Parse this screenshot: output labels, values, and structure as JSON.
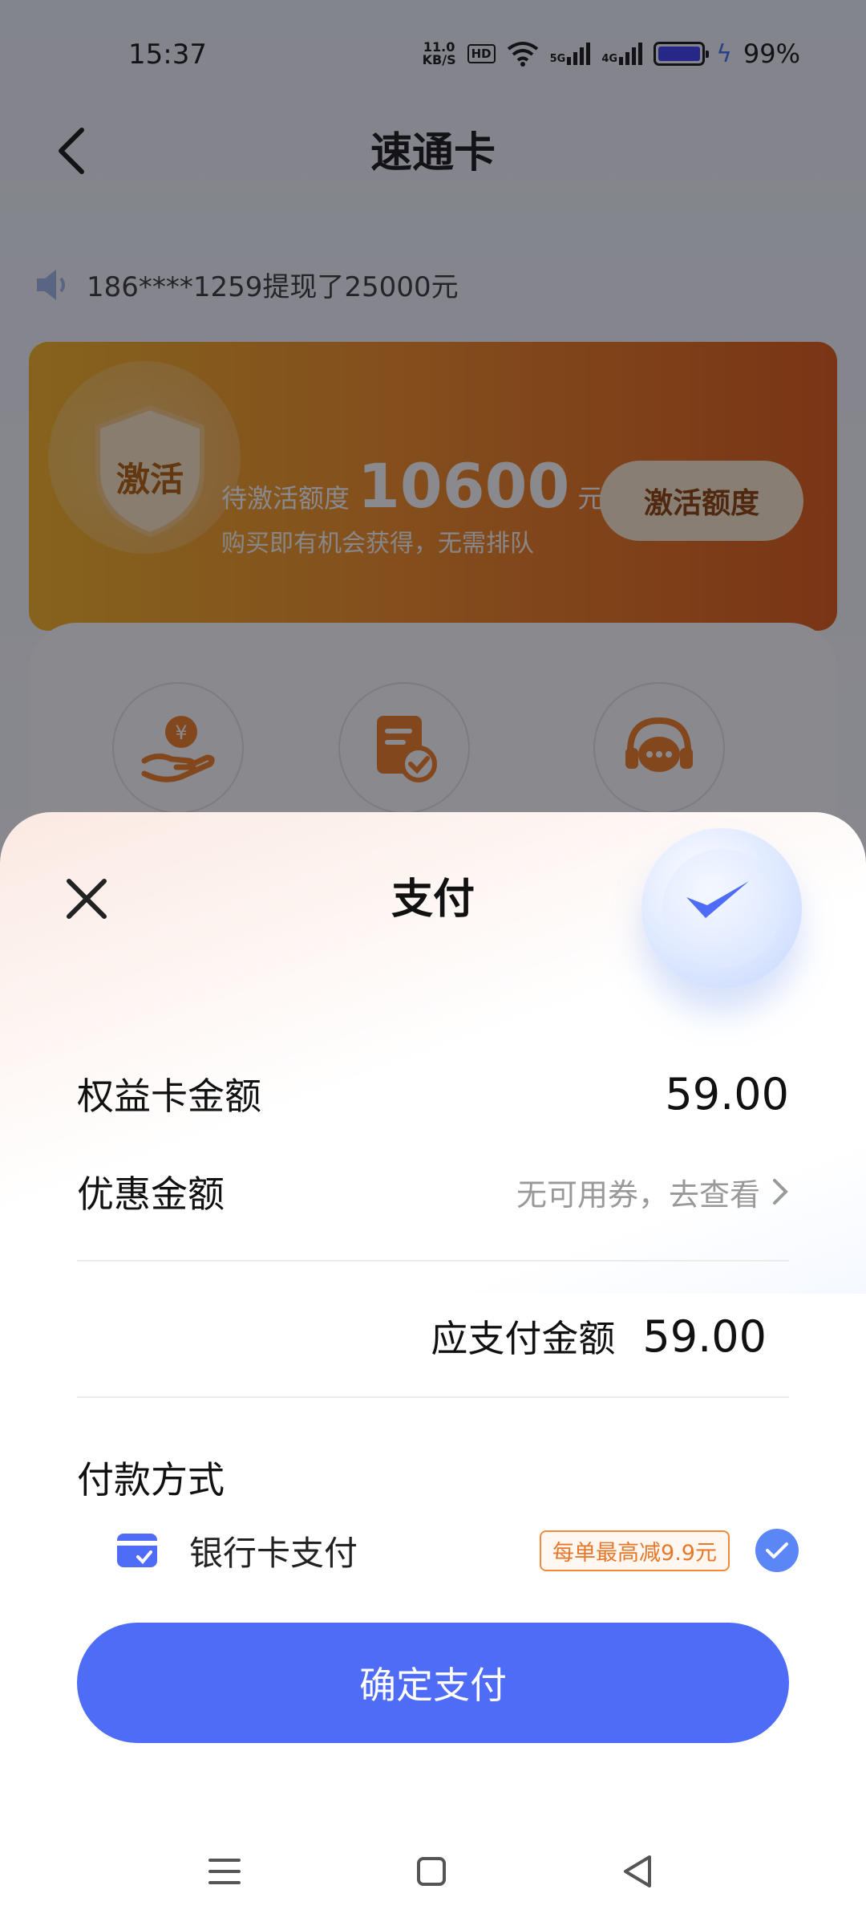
{
  "status_bar": {
    "time": "15:37",
    "net_speed_value": "11.0",
    "net_speed_unit": "KB/S",
    "hd": "HD",
    "signal1": "5G",
    "signal2": "4G",
    "battery": "99%",
    "battery_color": "#3a3af0"
  },
  "page": {
    "title": "速通卡",
    "notice": "186****1259提现了25000元",
    "promo": {
      "badge": "激活",
      "prefix": "待激活额度",
      "amount": "10600",
      "unit": "元",
      "subtitle": "购买即有机会获得，无需排队",
      "button": "激活额度"
    },
    "shortcuts": [
      "yuan-hand-icon",
      "document-check-icon",
      "customer-service-icon"
    ]
  },
  "sheet": {
    "title": "支付",
    "card_amount_label": "权益卡金额",
    "card_amount_value": "59.00",
    "discount_label": "优惠金额",
    "discount_hint": "无可用券，去查看",
    "total_label": "应支付金额",
    "total_value": "59.00",
    "pay_method_label": "付款方式",
    "pay_option_label": "银行卡支付",
    "pay_option_badge": "每单最高减9.9元",
    "confirm_button": "确定支付",
    "accent_color": "#4f6cf7"
  }
}
